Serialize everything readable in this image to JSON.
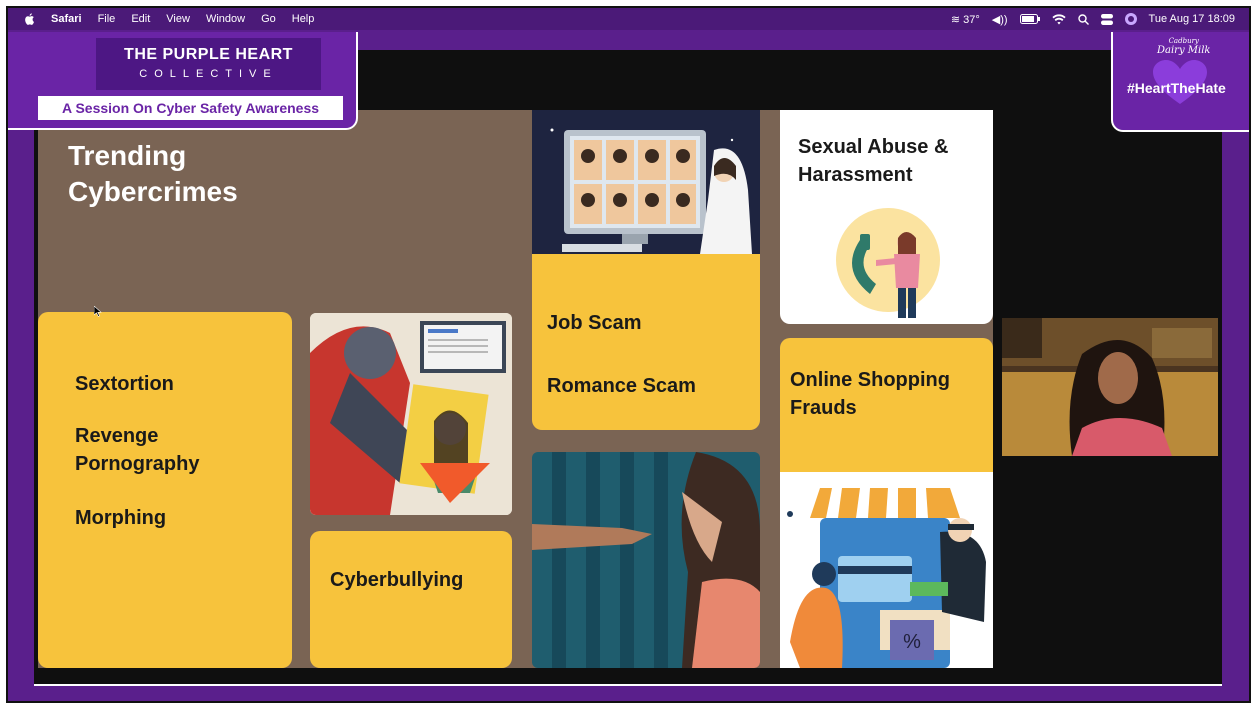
{
  "menubar": {
    "app_name": "Safari",
    "menus": [
      "File",
      "Edit",
      "View",
      "Window",
      "Go",
      "Help"
    ],
    "weather": "37°",
    "datetime": "Tue Aug 17  18:09"
  },
  "branding": {
    "org_line1": "THE PURPLE HEART",
    "org_line2": "COLLECTIVE",
    "session_title": "A Session On Cyber Safety Awareness",
    "sponsor_brand": "Dairy Milk",
    "sponsor_small": "Cadbury",
    "hashtag": "#HeartTheHate"
  },
  "slide": {
    "title_line1": "Trending",
    "title_line2": "Cybercrimes",
    "card_left": [
      "Sextortion",
      "Revenge",
      "Pornography",
      "Morphing"
    ],
    "card_cyberbullying": "Cyberbullying",
    "card_job": "Job Scam",
    "card_romance": "Romance Scam",
    "card_abuse_line1": "Sexual Abuse &",
    "card_abuse_line2": "Harassment",
    "card_shopping_line1": "Online Shopping",
    "card_shopping_line2": "Frauds",
    "percent_badge": "%"
  },
  "colors": {
    "frame_purple": "#6a24a6",
    "card_yellow": "#f7c33c",
    "slide_brown": "#7a6454"
  }
}
